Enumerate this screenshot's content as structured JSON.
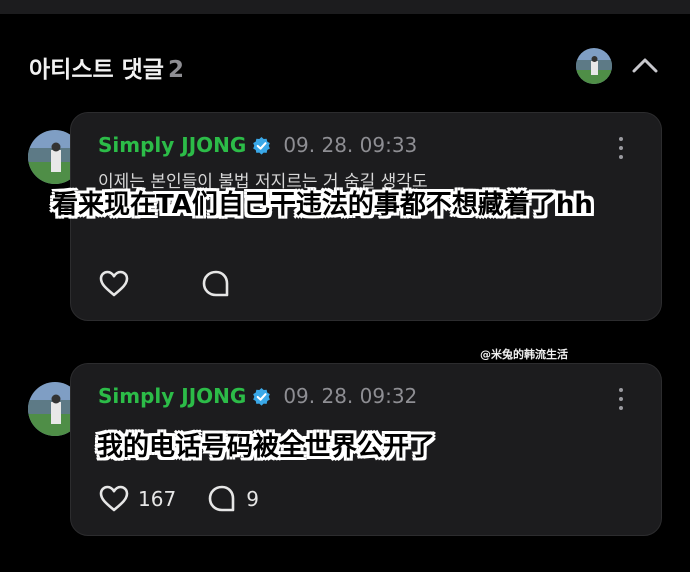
{
  "section": {
    "title": "아티스트 댓글",
    "count": "2"
  },
  "icons": {
    "collapse": "chevron-up-icon",
    "like": "heart-icon",
    "reply": "speech-bubble-icon",
    "more": "more-vertical-icon",
    "verified": "verified-badge-icon"
  },
  "colors": {
    "username": "#2cbc48",
    "verified": "#3aa8e8",
    "card_bg": "#1c1c1e",
    "background": "#000000"
  },
  "comments": [
    {
      "author": "Simply JJONG",
      "timestamp": "09. 28. 09:33",
      "text": "이제는 본인들이 불법 저지르는 거 숨길 생각도\n없나봐요ㅎㅎ",
      "caption": "看来现在TA们自己干违法的事都不想藏着了hh"
    },
    {
      "author": "Simply JJONG",
      "timestamp": "09. 28. 09:32",
      "caption": "我的电话号码被全世界公开了",
      "likes": "167",
      "replies": "9"
    }
  ],
  "watermark": "@米兔的韩流生活"
}
